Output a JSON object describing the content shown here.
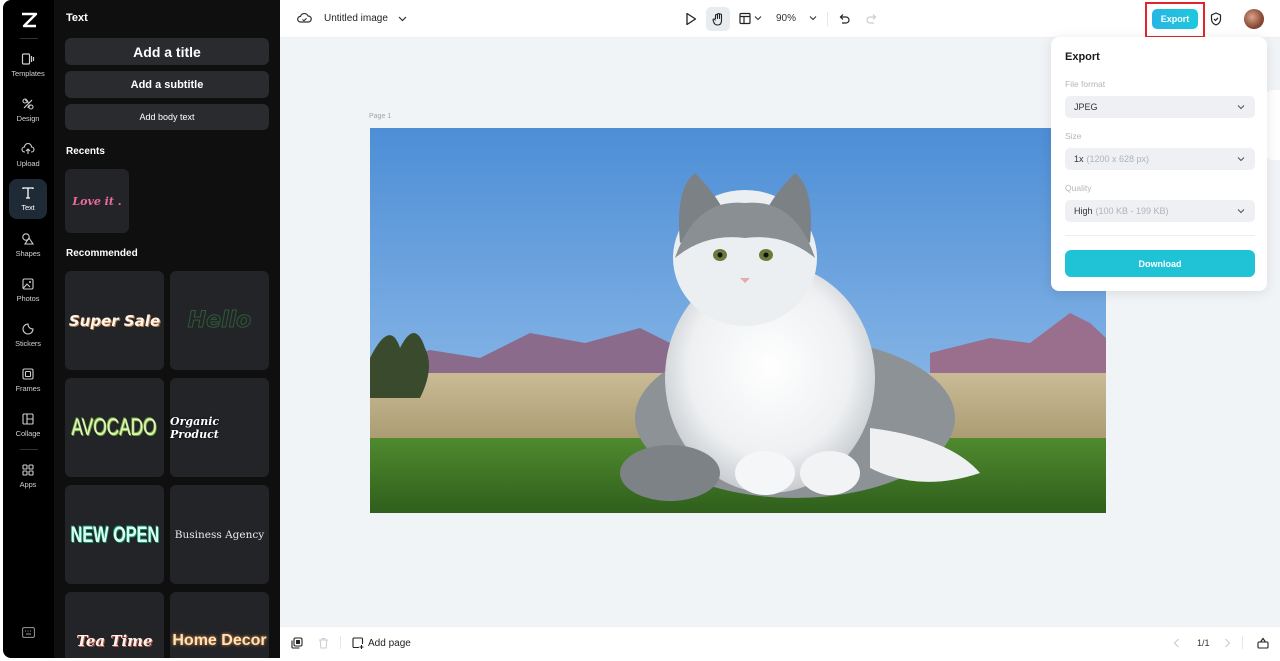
{
  "rail": {
    "items": [
      {
        "id": "templates",
        "label": "Templates",
        "icon": "templates-icon"
      },
      {
        "id": "design",
        "label": "Design",
        "icon": "design-icon"
      },
      {
        "id": "upload",
        "label": "Upload",
        "icon": "upload-icon"
      },
      {
        "id": "text",
        "label": "Text",
        "icon": "text-icon",
        "active": true
      },
      {
        "id": "shapes",
        "label": "Shapes",
        "icon": "shapes-icon"
      },
      {
        "id": "photos",
        "label": "Photos",
        "icon": "photos-icon"
      },
      {
        "id": "stickers",
        "label": "Stickers",
        "icon": "stickers-icon"
      },
      {
        "id": "frames",
        "label": "Frames",
        "icon": "frames-icon"
      },
      {
        "id": "collage",
        "label": "Collage",
        "icon": "collage-icon"
      },
      {
        "id": "apps",
        "label": "Apps",
        "icon": "apps-icon"
      }
    ]
  },
  "panel": {
    "title": "Text",
    "add_title": "Add a title",
    "add_subtitle": "Add a subtitle",
    "add_body": "Add body text",
    "recents_heading": "Recents",
    "recents": [
      {
        "text": "Love it .",
        "color": "#f06aa0"
      }
    ],
    "recommended_heading": "Recommended",
    "recommended": [
      {
        "text": "Super Sale",
        "color": "#fff4e6"
      },
      {
        "text": "Hello",
        "color": "#2f5a38"
      },
      {
        "text": "AVOCADO",
        "color": "#e8f4c0"
      },
      {
        "text": "Organic Product",
        "color": "#ffffff"
      },
      {
        "text": "NEW OPEN",
        "color": "#d7fff0"
      },
      {
        "text": "Business Agency",
        "color": "#e8e8ee"
      },
      {
        "text": "Tea Time",
        "color": "#fff1ea"
      },
      {
        "text": "Home Decor",
        "color": "#ffe2b8"
      }
    ]
  },
  "topbar": {
    "doc_title": "Untitled image",
    "zoom": "90%",
    "export_label": "Export"
  },
  "canvas": {
    "page_label": "Page 1",
    "image_alt": "Fluffy white and grey cat sitting on grass in front of mountains"
  },
  "bottombar": {
    "add_page": "Add page",
    "page_indicator": "1/1"
  },
  "export_panel": {
    "title": "Export",
    "file_format_label": "File format",
    "file_format_value": "JPEG",
    "size_label": "Size",
    "size_value": "1x",
    "size_hint": "(1200 x 628 px)",
    "quality_label": "Quality",
    "quality_value": "High",
    "quality_hint": "(100 KB - 199 KB)",
    "download_label": "Download"
  },
  "colors": {
    "accent": "#20c3d6",
    "highlight_border": "#e0262b"
  }
}
